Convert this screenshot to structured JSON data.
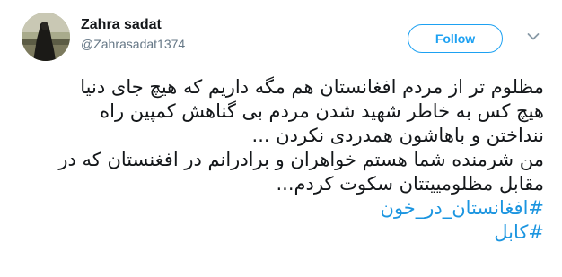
{
  "user": {
    "display_name": "Zahra sadat",
    "screen_name": "@Zahrasadat1374"
  },
  "follow_button": {
    "label": "Follow"
  },
  "icons": {
    "avatar": "profile-photo-silhouette",
    "menu": "chevron-down-icon"
  },
  "colors": {
    "accent": "#1da1f2",
    "hashtag": "#1b95e0",
    "text": "#14171a",
    "secondary": "#657786"
  },
  "tweet": {
    "lines": [
      "مظلوم تر از مردم افغانستان هم مگه داریم که هیچ جای دنیا",
      "هیچ کس به خاطر شهید شدن مردم بی گناهش کمپین راه",
      "ننداختن و باهاشون همدردی نکردن ...",
      "من شرمنده شما هستم خواهران و برادرانم در افغنستان که در",
      "مقابل مظلومییتتان سکوت کردم..."
    ],
    "hashtags": [
      "#افغانستان_در_خون",
      "#کابل"
    ]
  }
}
